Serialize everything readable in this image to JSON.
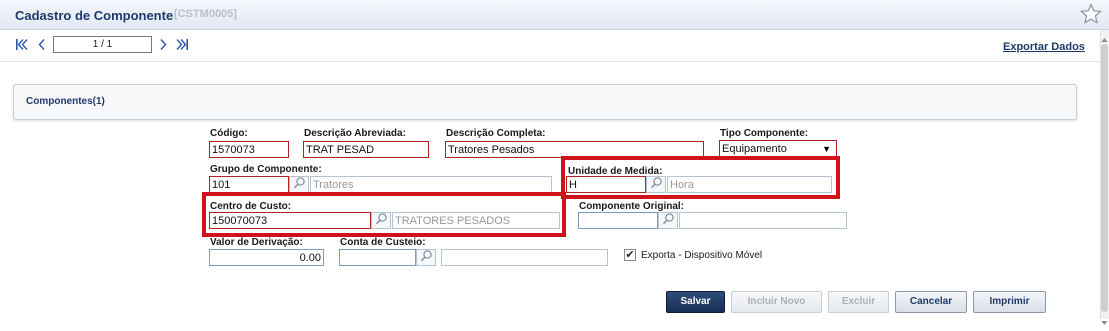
{
  "window": {
    "title": "Cadastro de Componente",
    "code": "[CSTM0005]"
  },
  "nav": {
    "page_indicator": "1 / 1"
  },
  "toolbar": {
    "export_label": "Exportar Dados"
  },
  "panel": {
    "title": "Componentes(1)"
  },
  "form": {
    "codigo": {
      "label": "Código:",
      "value": "1570073"
    },
    "descricao_abreviada": {
      "label": "Descrição Abreviada:",
      "value": "TRAT PESAD"
    },
    "descricao_completa": {
      "label": "Descrição Completa:",
      "value": "Tratores Pesados"
    },
    "tipo_componente": {
      "label": "Tipo Componente:",
      "value": "Equipamento",
      "arrow": "▼"
    },
    "grupo_componente": {
      "label": "Grupo de Componente:",
      "code": "101",
      "description": "Tratores"
    },
    "unidade_medida": {
      "label": "Unidade de Medida:",
      "code": "H",
      "description": "Hora"
    },
    "centro_custo": {
      "label": "Centro de Custo:",
      "code": "150070073",
      "description": "TRATORES PESADOS"
    },
    "componente_original": {
      "label": "Componente Original:",
      "code": "",
      "description": ""
    },
    "valor_derivacao": {
      "label": "Valor de Derivação:",
      "value": "0.00"
    },
    "conta_custeio": {
      "label": "Conta de Custeio:",
      "code": "",
      "description": ""
    },
    "exporta_dispositivo": {
      "label": "Exporta - Dispositivo Móvel",
      "checked": true,
      "mark": "✔"
    }
  },
  "buttons": {
    "salvar": "Salvar",
    "incluir_novo": "Incluir Novo",
    "excluir": "Excluir",
    "cancelar": "Cancelar",
    "imprimir": "Imprimir"
  },
  "colors": {
    "highlight": "#d0121a",
    "primary_button": "#1f3a6a",
    "required_border": "#b22222"
  }
}
